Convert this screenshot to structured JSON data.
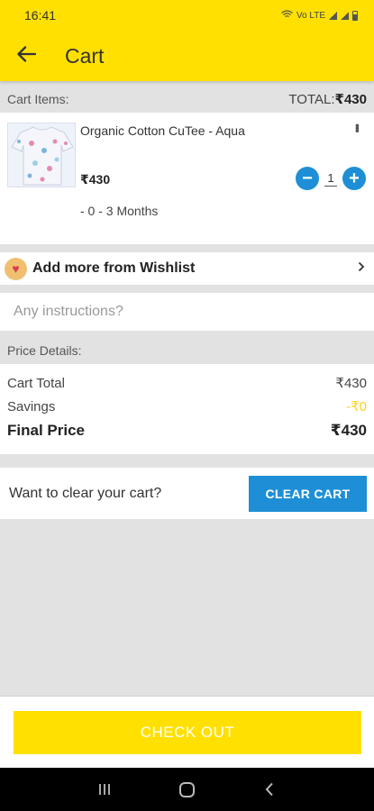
{
  "status": {
    "time": "16:41",
    "network": "Vo LTE"
  },
  "app_bar": {
    "title": "Cart"
  },
  "cart": {
    "header_label": "Cart Items:",
    "total_prefix": "TOTAL:",
    "total_value": "₹430",
    "item": {
      "name": "Organic Cotton CuTee - Aqua",
      "price": "₹430",
      "quantity": "1",
      "size": "- 0 - 3 Months"
    }
  },
  "wishlist": {
    "label": "Add more from Wishlist"
  },
  "instructions": {
    "placeholder": "Any instructions?"
  },
  "price_details": {
    "header": "Price Details:",
    "cart_total_label": "Cart Total",
    "cart_total_value": "₹430",
    "savings_label": "Savings",
    "savings_value": "-₹0",
    "final_label": "Final Price",
    "final_value": "₹430"
  },
  "clear": {
    "label": "Want to clear your cart?",
    "button": "CLEAR CART"
  },
  "checkout": {
    "button": "CHECK OUT"
  },
  "colors": {
    "brand": "#ffe000",
    "accent": "#1e8fd6"
  }
}
